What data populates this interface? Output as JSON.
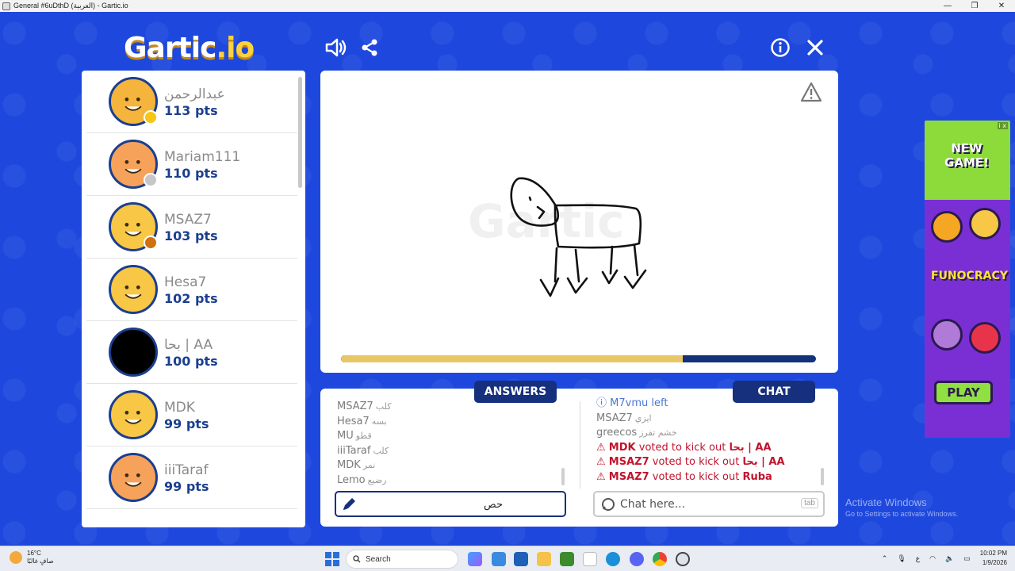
{
  "window": {
    "title": "General #6uDthD (العربية) - Gartic.io",
    "controls": [
      "—",
      "❐",
      "✕"
    ]
  },
  "logo": {
    "text": "Gartic",
    "suffix": ".io"
  },
  "players": [
    {
      "name": "عبدالرحمن",
      "points": "113 pts",
      "badge_color": "#f5c518",
      "avatar_bg": "#f5b43c"
    },
    {
      "name": "Mariam111",
      "points": "110 pts",
      "badge_color": "#c7c7c7",
      "avatar_bg": "#f7a25a"
    },
    {
      "name": "MSAZ7",
      "points": "103 pts",
      "badge_color": "#d0700e",
      "avatar_bg": "#f7c745"
    },
    {
      "name": "Hesa7",
      "points": "102 pts",
      "badge_color": "",
      "avatar_bg": "#f7c745"
    },
    {
      "name": "بحا | AA",
      "points": "100 pts",
      "badge_color": "",
      "avatar_bg": "#000000"
    },
    {
      "name": "MDK",
      "points": "99 pts",
      "badge_color": "",
      "avatar_bg": "#f7c745"
    },
    {
      "name": "iiiTaraf",
      "points": "99 pts",
      "badge_color": "",
      "avatar_bg": "#f7a25a"
    }
  ],
  "canvas": {
    "progress": 0.72
  },
  "answers": {
    "label": "ANSWERS",
    "messages": [
      {
        "user": "MSAZ7",
        "guess": "كلب"
      },
      {
        "user": "Hesa7",
        "guess": "بسه"
      },
      {
        "user": "MU",
        "guess": "قطو"
      },
      {
        "user": "iiiTaraf",
        "guess": "كلب"
      },
      {
        "user": "MDK",
        "guess": "نمر"
      },
      {
        "user": "Lemo",
        "guess": "رضيع"
      }
    ],
    "input_value": "حص"
  },
  "chat": {
    "label": "CHAT",
    "system": {
      "user": "M7vmu",
      "text": "left"
    },
    "messages": [
      {
        "user": "MSAZ7",
        "text": "ايزي"
      },
      {
        "user": "greecos",
        "text": "خشم تفرز"
      }
    ],
    "kicks": [
      {
        "user": "MDK",
        "text": "voted to kick out",
        "target": "بحا | AA"
      },
      {
        "user": "MSAZ7",
        "text": "voted to kick out",
        "target": "بحا | AA"
      },
      {
        "user": "MSAZ7",
        "text": "voted to kick out",
        "target": "Ruba"
      }
    ],
    "placeholder": "Chat here...",
    "tab_hint": "tab"
  },
  "ad": {
    "tag": "i x",
    "headline": "NEW GAME!",
    "brand": "FUNOCRACY",
    "cta": "PLAY"
  },
  "watermark": {
    "line1": "Activate Windows",
    "line2": "Go to Settings to activate Windows."
  },
  "taskbar": {
    "weather_temp": "16°C",
    "weather_desc": "صافٍ غالبًا",
    "search_label": "Search",
    "time": "10:02 PM",
    "date": "1/9/2026",
    "lang": "ع"
  }
}
